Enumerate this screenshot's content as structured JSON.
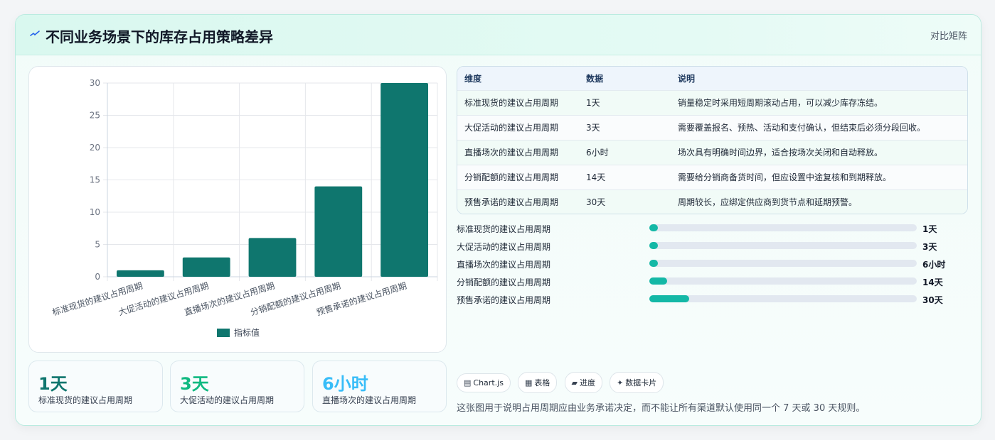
{
  "header": {
    "title": "不同业务场景下的库存占用策略差异",
    "badge": "对比矩阵",
    "icon": "lightning-icon"
  },
  "chart_data": {
    "type": "bar",
    "categories": [
      "标准现货的建议占用周期",
      "大促活动的建议占用周期",
      "直播场次的建议占用周期",
      "分销配额的建议占用周期",
      "预售承诺的建议占用周期"
    ],
    "series": [
      {
        "name": "指标值",
        "values": [
          1,
          3,
          6,
          14,
          30
        ]
      }
    ],
    "yticks": [
      "0",
      "5",
      "10",
      "15",
      "20",
      "25",
      "30"
    ],
    "ylim": [
      0,
      30
    ],
    "legend_position": "bottom",
    "grid": true,
    "color": "#0f766e"
  },
  "kpis": [
    {
      "value": "1天",
      "label": "标准现货的建议占用周期",
      "color": "#0f766e"
    },
    {
      "value": "3天",
      "label": "大促活动的建议占用周期",
      "color": "#10b981"
    },
    {
      "value": "6小时",
      "label": "直播场次的建议占用周期",
      "color": "#38bdf8"
    }
  ],
  "table": {
    "headers": [
      "维度",
      "数据",
      "说明"
    ],
    "rows": [
      [
        "标准现货的建议占用周期",
        "1天",
        "销量稳定时采用短周期滚动占用，可以减少库存冻结。"
      ],
      [
        "大促活动的建议占用周期",
        "3天",
        "需要覆盖报名、预热、活动和支付确认，但结束后必须分段回收。"
      ],
      [
        "直播场次的建议占用周期",
        "6小时",
        "场次具有明确时间边界，适合按场次关闭和自动释放。"
      ],
      [
        "分销配额的建议占用周期",
        "14天",
        "需要给分销商备货时间，但应设置中途复核和到期释放。"
      ],
      [
        "预售承诺的建议占用周期",
        "30天",
        "周期较长，应绑定供应商到货节点和延期预警。"
      ]
    ]
  },
  "progress": [
    {
      "label": "标准现货的建议占用周期",
      "value": "1天",
      "fraction": 0.033
    },
    {
      "label": "大促活动的建议占用周期",
      "value": "3天",
      "fraction": 0.033
    },
    {
      "label": "直播场次的建议占用周期",
      "value": "6小时",
      "fraction": 0.033
    },
    {
      "label": "分销配额的建议占用周期",
      "value": "14天",
      "fraction": 0.067
    },
    {
      "label": "预售承诺的建议占用周期",
      "value": "30天",
      "fraction": 0.15
    }
  ],
  "tags": [
    {
      "icon": "chart-icon",
      "glyph": "▤",
      "label": "Chart.js"
    },
    {
      "icon": "table-icon",
      "glyph": "▦",
      "label": "表格"
    },
    {
      "icon": "progress-icon",
      "glyph": "▰",
      "label": "进度"
    },
    {
      "icon": "card-icon",
      "glyph": "✦",
      "label": "数据卡片"
    }
  ],
  "footnote": "这张图用于说明占用周期应由业务承诺决定，而不能让所有渠道默认使用同一个 7 天或 30 天规则。"
}
